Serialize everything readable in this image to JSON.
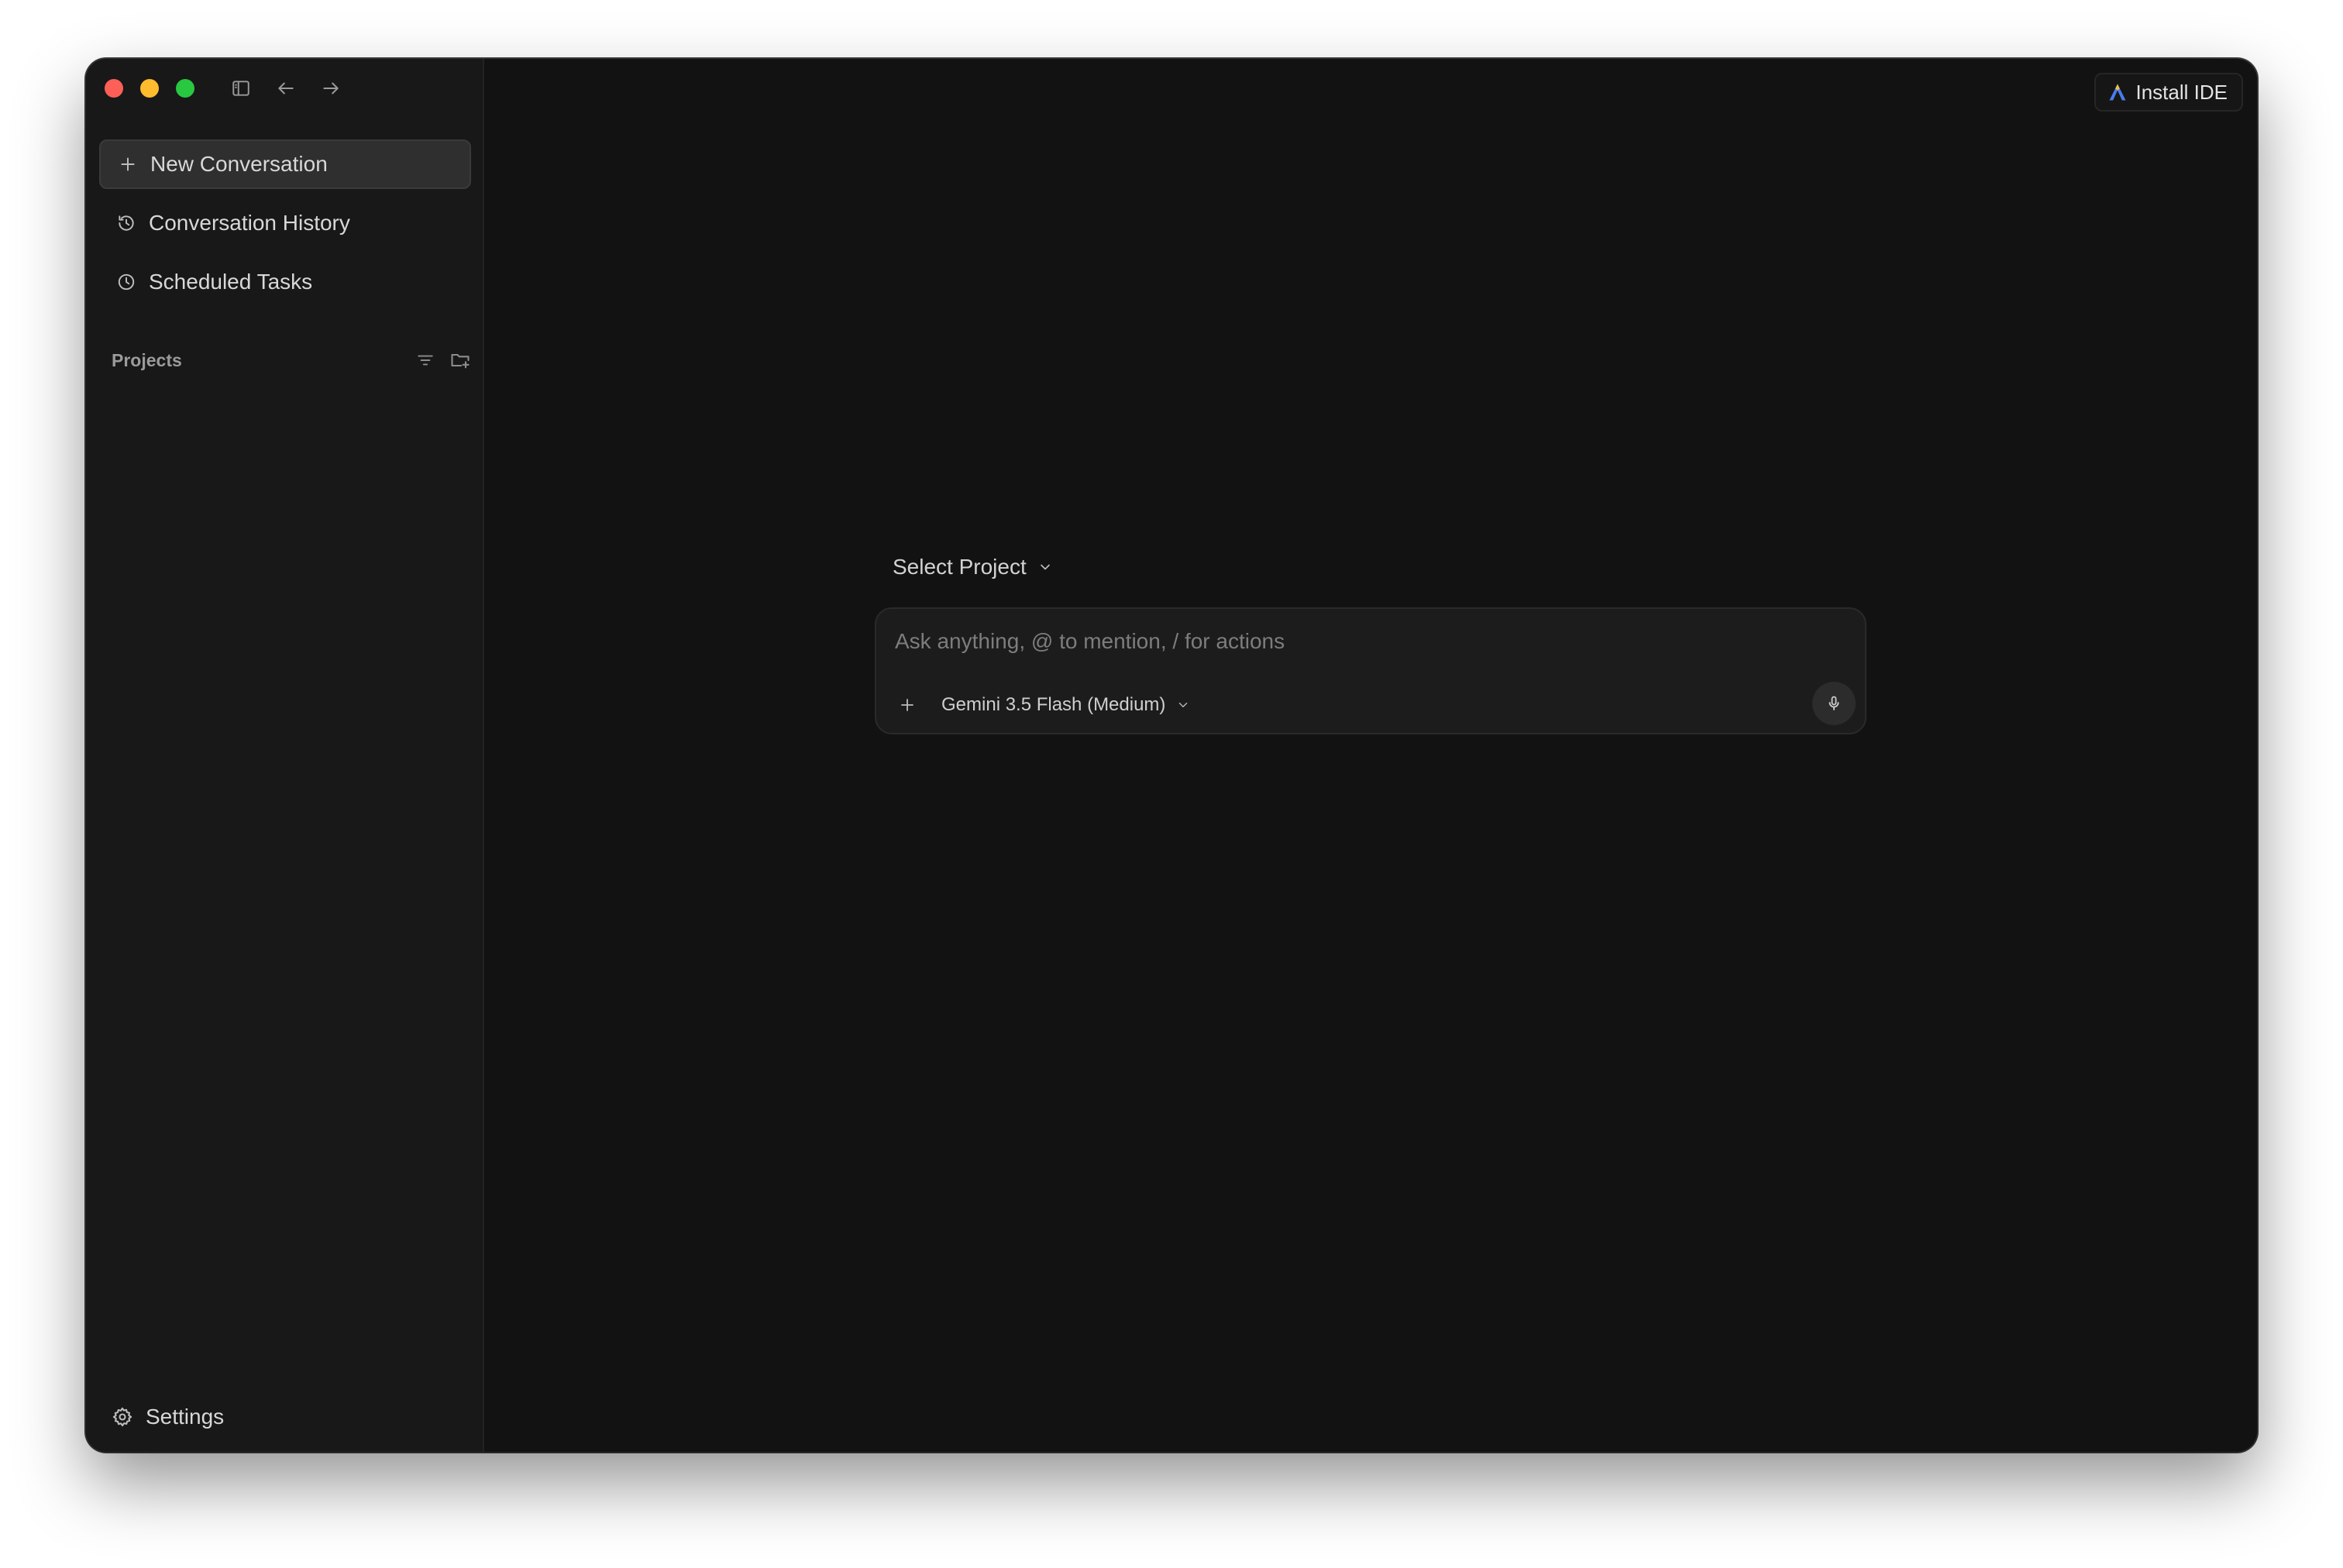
{
  "window": {
    "traffic_lights": [
      {
        "name": "close",
        "color": "#fe5f57"
      },
      {
        "name": "minimize",
        "color": "#febc2e"
      },
      {
        "name": "maximize",
        "color": "#28c840"
      }
    ],
    "titlebar_icons": [
      "sidebar-toggle-icon",
      "back-arrow-icon",
      "forward-arrow-icon"
    ]
  },
  "sidebar": {
    "items": [
      {
        "label": "New Conversation",
        "icon": "plus-icon",
        "active": true
      },
      {
        "label": "Conversation History",
        "icon": "history-icon",
        "active": false
      },
      {
        "label": "Scheduled Tasks",
        "icon": "clock-icon",
        "active": false
      }
    ],
    "projects": {
      "label": "Projects",
      "actions": [
        "filter-icon",
        "new-folder-icon"
      ]
    },
    "settings_label": "Settings"
  },
  "header": {
    "install_ide_label": "Install IDE"
  },
  "main": {
    "select_project_label": "Select Project",
    "composer": {
      "placeholder": "Ask anything, @ to mention, / for actions",
      "value": "",
      "model_label": "Gemini 3.5 Flash (Medium)"
    }
  },
  "colors": {
    "window_bg": "#121212",
    "sidebar_bg": "#181818",
    "active_item_bg": "#2f2f2f",
    "composer_bg": "#1c1c1c",
    "accent_logo": "#4a7cf0"
  }
}
